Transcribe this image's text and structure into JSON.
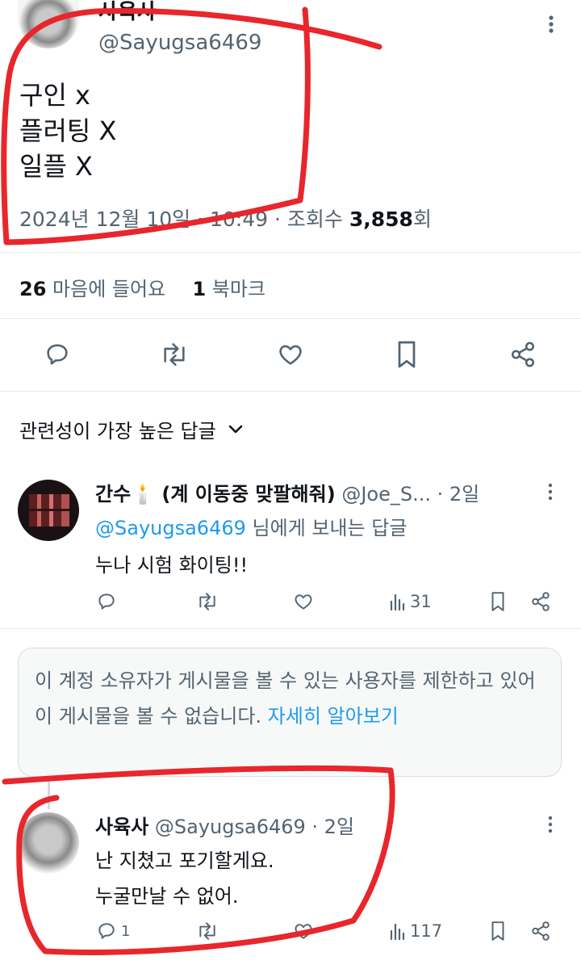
{
  "main_tweet": {
    "author_name": "사육사",
    "handle": "@Sayugsa6469",
    "lines": [
      "구인 x",
      "플러팅 X",
      "일플 X"
    ],
    "date": "2024년 12월 10일",
    "time": "10:49",
    "views_label": "조회수",
    "views_count": "3,858",
    "views_suffix": "회",
    "likes_count": "26",
    "likes_label": "마음에 들어요",
    "bookmarks_count": "1",
    "bookmarks_label": "북마크"
  },
  "sort": {
    "label": "관련성이 가장 높은 답글"
  },
  "reply1": {
    "author_name": "간수🕯️ (계 이동중 맞팔해줘)",
    "handle": "@Joe_S...",
    "time": "· 2일",
    "reply_to_handle": "@Sayugsa6469",
    "reply_to_suffix": "님에게 보내는 답글",
    "text": "누나 시험 화이팅!!",
    "views": "31"
  },
  "restricted_notice": {
    "text": "이 계정 소유자가 게시물을 볼 수 있는 사용자를 제한하고 있어 이 게시물을 볼 수 없습니다.",
    "link": "자세히 알아보기"
  },
  "reply2": {
    "author_name": "사육사",
    "handle": "@Sayugsa6469",
    "time": "· 2일",
    "line1": "난 지쳤고 포기할게요.",
    "line2": "누굴만날 수 없어.",
    "replies": "1",
    "views": "117"
  },
  "colors": {
    "accent": "#1d9bf0",
    "annotation": "#e8262c",
    "muted": "#536471"
  },
  "icons": [
    "more-icon",
    "reply-icon",
    "retweet-icon",
    "like-icon",
    "bookmark-icon",
    "share-icon",
    "views-icon",
    "chevron-down-icon"
  ]
}
